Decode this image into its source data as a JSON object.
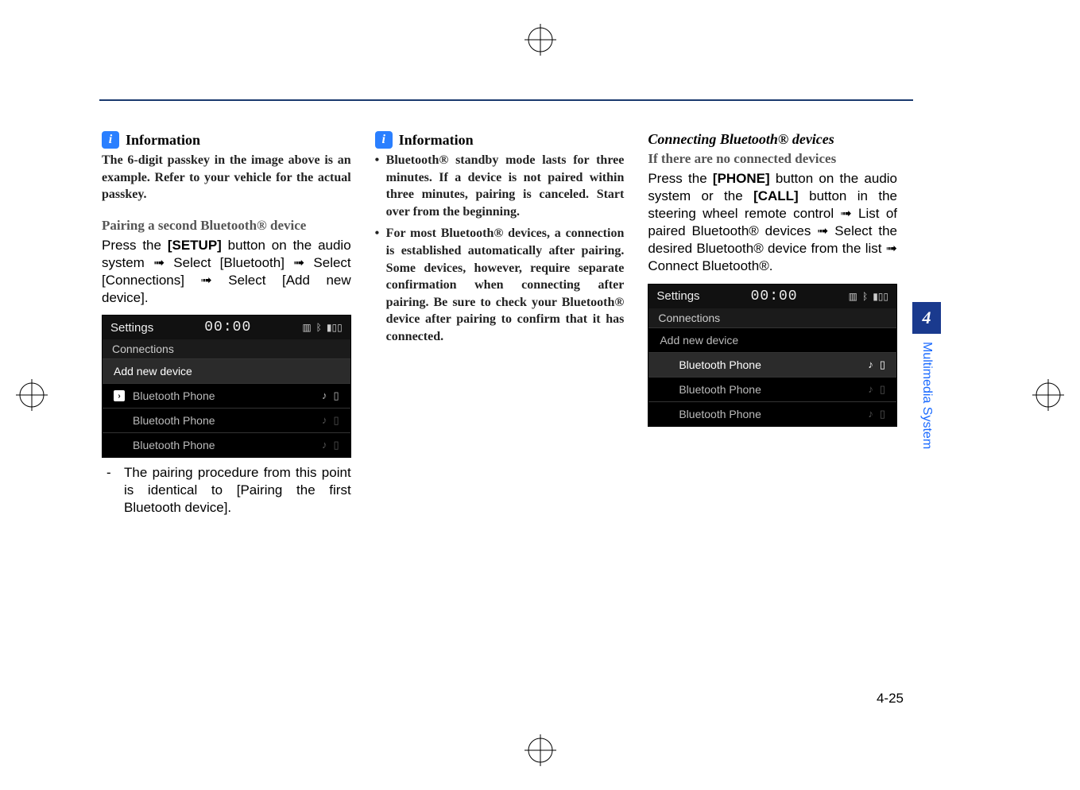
{
  "col1": {
    "info_label": "Information",
    "info_body": "The 6-digit passkey in the image above is an example. Refer to your vehicle for the actual passkey.",
    "heading": "Pairing a second Bluetooth® device",
    "body_pre": "Press the ",
    "body_btn": "[SETUP]",
    "body_post": " button on the audio system ➟ Select [Bluetooth] ➟ Select [Connections] ➟ Select [Add new device].",
    "settings": {
      "title": "Settings",
      "time": "00:00",
      "sub": "Connections",
      "add": "Add new device",
      "phone": "Bluetooth Phone"
    },
    "dash": "The pairing procedure from this point is identical to [Pairing the first Bluetooth device]."
  },
  "col2": {
    "info_label": "Information",
    "b1": "Bluetooth® standby mode lasts for three minutes. If a device is not paired within three minutes, pairing is canceled. Start over from the beginning.",
    "b2": "For most Bluetooth® devices, a connection is established automatically after pairing. Some devices, however, require separate confirmation when connecting after pairing. Be sure to check your Bluetooth® device after pairing to confirm that it has connected."
  },
  "col3": {
    "title": "Connecting Bluetooth® devices",
    "heading": "If there are no connected devices",
    "body_pre": "Press the ",
    "body_btn1": "[PHONE]",
    "body_mid": " button on the audio system or the ",
    "body_btn2": "[CALL]",
    "body_post": " button in the steering wheel remote control ➟ List of paired Bluetooth® devices ➟ Select the desired Bluetooth® device from the list ➟ Connect Bluetooth®.",
    "settings": {
      "title": "Settings",
      "time": "00:00",
      "sub": "Connections",
      "add": "Add new device",
      "phone": "Bluetooth Phone"
    }
  },
  "tab": {
    "num": "4",
    "label": "Multimedia System"
  },
  "page_num": "4-25"
}
